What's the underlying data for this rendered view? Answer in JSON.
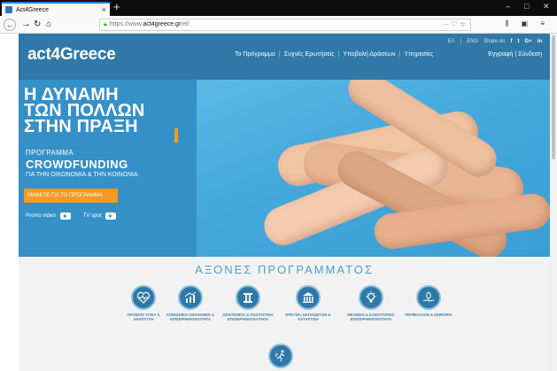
{
  "browser": {
    "tab_title": "Act4Greece",
    "tab_close": "×",
    "new_tab": "+",
    "url_prefix": "https://www.",
    "url_domain": "act4greece.gr",
    "url_suffix": "/el/",
    "url_actions": "··· ♡ ☆",
    "right_icons": "⫼ ▣ ≡",
    "window_controls": {
      "minimize": "–",
      "maximize": "□",
      "close": "✕"
    }
  },
  "site": {
    "logo": "act4Greece",
    "lang_el": "ΕΛ",
    "lang_en": "ENG",
    "share_on": "Share on",
    "social": [
      "f",
      "t",
      "G+",
      "in"
    ],
    "nav": [
      "Το Πρόγραμμα",
      "Συχνές Ερωτήσεις",
      "Υποβολή Δράσεων",
      "Υπηρεσίες"
    ],
    "auth": "Εγγραφή | Σύνδεση"
  },
  "hero": {
    "headline_lines": [
      "Η ΔΥΝΑΜΗ",
      "ΤΩΝ ΠΟΛΛΩΝ",
      "ΣΤΗΝ ΠΡΑΞΗ"
    ],
    "program_label": "ΠΡΟΓΡΑΜΜΑ",
    "crowdfunding": "CROWDFUNDING",
    "subtitle": "ΓΙΑ ΤΗΝ ΟΙΚΟΝΟΜΙΑ & ΤΗΝ ΚΟΙΝΩΝΙΑ",
    "cta": "ΜΑΘΕΤΕ ΓΙΑ ΤΟ ΠΡΟΓΡΑΜΜΑ",
    "promo_video": "Promo video",
    "tv_spot": "TV spot"
  },
  "pillars_section": {
    "title": "ΑΞΟΝΕΣ ΠΡΟΓΡΑΜΜΑΤΟΣ",
    "pillars": [
      {
        "icon": "heart-pulse-icon",
        "label": "ΠΡΟΝΟΙΑ ΥΓΕΙΑ & ΑΝΑΠΤΥΞΗ"
      },
      {
        "icon": "growth-chart-icon",
        "label": "ΚΟΙΝΩΝΙΚΗ ΟΙΚΟΝΟΜΙΑ & ΕΠΙΧΕΙΡΗΜΑΤΙΚΟΤΗΤΑ"
      },
      {
        "icon": "column-icon",
        "label": "ΠΟΛΙΤΙΣΜΟΣ & ΠΟΛΙΤΙΣΤΙΚΗ ΕΠΙΧΕΙΡΗΜΑΤΙΚΟΤΗΤΑ"
      },
      {
        "icon": "institution-icon",
        "label": "ΕΡΕΥΝΑ, ΕΚΠΑΙΔΕΥΣΗ & ΚΑΤΑΡΤΙΣΗ"
      },
      {
        "icon": "lightbulb-icon",
        "label": "ΝΕΑΝΙΚΗ & ΚΑΙΝΟΤΟΜΟΣ ΕΠΙΧΕΙΡΗΜΑΤΙΚΟΤΗΤΑ"
      },
      {
        "icon": "plant-hand-icon",
        "label": "ΠΕΡΙΒΑΛΛΟΝ & ΑΕΙΦΟΡΙΑ"
      },
      {
        "icon": "running-figure-icon",
        "label": ""
      }
    ]
  },
  "colors": {
    "header_blue": "#2f78a8",
    "hero_blue": "#3590c8",
    "accent_orange": "#f59a23",
    "section_title": "#4d9ec4"
  }
}
